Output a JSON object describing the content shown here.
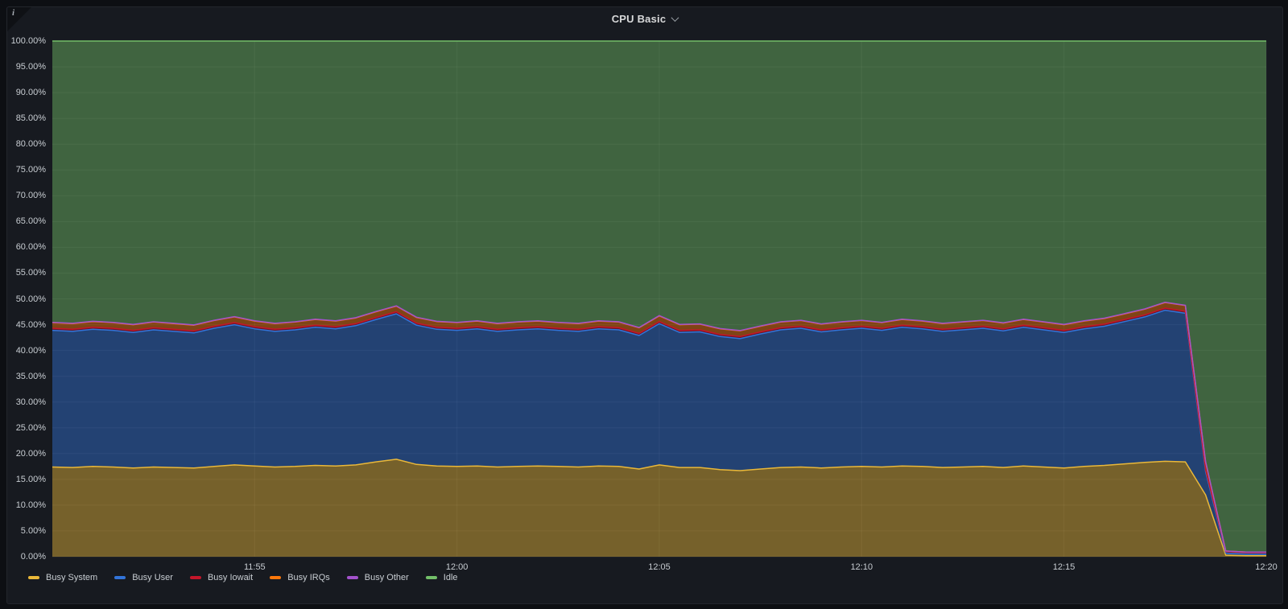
{
  "panel": {
    "title": "CPU Basic",
    "info_icon": "i",
    "chevron_icon": "chevron-down"
  },
  "colors": {
    "page_bg": "#0d0f13",
    "panel_bg": "#171a20",
    "grid": "rgba(255,255,255,0.07)",
    "axis_text": "#c8cdd2",
    "title_text": "#d8d9da"
  },
  "chart_data": {
    "type": "area",
    "stacked": true,
    "unit": "percent",
    "title": "CPU Basic",
    "grid": true,
    "legend_position": "bottom-left",
    "ylim": [
      0,
      100
    ],
    "x_start_label": "11:50",
    "x_minutes_span": 30,
    "x_step_minutes": 0.5,
    "fill_opacity": 0.45,
    "x_ticks": [
      {
        "t": 5,
        "label": "11:55"
      },
      {
        "t": 10,
        "label": "12:00"
      },
      {
        "t": 15,
        "label": "12:05"
      },
      {
        "t": 20,
        "label": "12:10"
      },
      {
        "t": 25,
        "label": "12:15"
      },
      {
        "t": 30,
        "label": "12:20"
      }
    ],
    "y_ticks": [
      {
        "value": 100,
        "label": "100.00%"
      },
      {
        "value": 95,
        "label": "95.00%"
      },
      {
        "value": 90,
        "label": "90.00%"
      },
      {
        "value": 85,
        "label": "85.00%"
      },
      {
        "value": 80,
        "label": "80.00%"
      },
      {
        "value": 75,
        "label": "75.00%"
      },
      {
        "value": 70,
        "label": "70.00%"
      },
      {
        "value": 65,
        "label": "65.00%"
      },
      {
        "value": 60,
        "label": "60.00%"
      },
      {
        "value": 55,
        "label": "55.00%"
      },
      {
        "value": 50,
        "label": "50.00%"
      },
      {
        "value": 45,
        "label": "45.00%"
      },
      {
        "value": 40,
        "label": "40.00%"
      },
      {
        "value": 35,
        "label": "35.00%"
      },
      {
        "value": 30,
        "label": "30.00%"
      },
      {
        "value": 25,
        "label": "25.00%"
      },
      {
        "value": 20,
        "label": "20.00%"
      },
      {
        "value": 15,
        "label": "15.00%"
      },
      {
        "value": 10,
        "label": "10.00%"
      },
      {
        "value": 5,
        "label": "5.00%"
      },
      {
        "value": 0,
        "label": "0.00%"
      }
    ],
    "series": [
      {
        "name": "Busy System",
        "color": "#EAB839",
        "values": [
          17.4,
          17.3,
          17.5,
          17.4,
          17.2,
          17.4,
          17.3,
          17.2,
          17.5,
          17.8,
          17.6,
          17.4,
          17.5,
          17.7,
          17.6,
          17.8,
          18.4,
          18.9,
          17.9,
          17.6,
          17.5,
          17.6,
          17.4,
          17.5,
          17.6,
          17.5,
          17.4,
          17.6,
          17.5,
          17.0,
          17.8,
          17.3,
          17.3,
          16.9,
          16.7,
          17.0,
          17.3,
          17.4,
          17.2,
          17.4,
          17.5,
          17.4,
          17.6,
          17.5,
          17.3,
          17.4,
          17.5,
          17.3,
          17.6,
          17.4,
          17.2,
          17.5,
          17.7,
          18.0,
          18.3,
          18.5,
          18.4,
          12.0,
          0.3,
          0.2,
          0.2
        ]
      },
      {
        "name": "Busy User",
        "color": "#3274D9",
        "values": [
          26.5,
          26.4,
          26.6,
          26.5,
          26.3,
          26.6,
          26.4,
          26.2,
          26.8,
          27.2,
          26.6,
          26.3,
          26.5,
          26.8,
          26.6,
          27.0,
          27.6,
          28.2,
          27.0,
          26.5,
          26.4,
          26.6,
          26.3,
          26.5,
          26.6,
          26.4,
          26.3,
          26.6,
          26.5,
          25.9,
          27.4,
          26.2,
          26.3,
          25.8,
          25.6,
          26.2,
          26.7,
          26.9,
          26.4,
          26.6,
          26.8,
          26.5,
          26.9,
          26.7,
          26.4,
          26.6,
          26.8,
          26.5,
          26.9,
          26.6,
          26.3,
          26.7,
          27.0,
          27.6,
          28.2,
          29.3,
          28.8,
          4.5,
          0.4,
          0.3,
          0.3
        ]
      },
      {
        "name": "Busy Iowait",
        "color": "#C4162A",
        "values": [
          0.4,
          0.4,
          0.4,
          0.4,
          0.4,
          0.4,
          0.4,
          0.4,
          0.4,
          0.4,
          0.4,
          0.4,
          0.4,
          0.4,
          0.4,
          0.4,
          0.4,
          0.4,
          0.4,
          0.4,
          0.4,
          0.4,
          0.4,
          0.4,
          0.4,
          0.4,
          0.4,
          0.4,
          0.4,
          0.4,
          0.4,
          0.4,
          0.4,
          0.4,
          0.4,
          0.4,
          0.4,
          0.4,
          0.4,
          0.4,
          0.4,
          0.4,
          0.4,
          0.4,
          0.4,
          0.4,
          0.4,
          0.4,
          0.4,
          0.4,
          0.4,
          0.4,
          0.4,
          0.4,
          0.4,
          0.4,
          0.4,
          0.4,
          0.3,
          0.3,
          0.3
        ]
      },
      {
        "name": "Busy IRQs",
        "color": "#FF780A",
        "values": [
          1.1,
          1.1,
          1.1,
          1.1,
          1.1,
          1.1,
          1.1,
          1.1,
          1.1,
          1.1,
          1.1,
          1.1,
          1.1,
          1.1,
          1.1,
          1.1,
          1.1,
          1.1,
          1.1,
          1.1,
          1.1,
          1.1,
          1.1,
          1.1,
          1.1,
          1.1,
          1.1,
          1.1,
          1.1,
          1.1,
          1.1,
          1.1,
          1.1,
          1.1,
          1.1,
          1.1,
          1.1,
          1.1,
          1.1,
          1.1,
          1.1,
          1.1,
          1.1,
          1.1,
          1.1,
          1.1,
          1.1,
          1.1,
          1.1,
          1.1,
          1.1,
          1.1,
          1.1,
          1.1,
          1.1,
          1.1,
          1.1,
          1.5,
          0.1,
          0.1,
          0.1
        ]
      },
      {
        "name": "Busy Other",
        "color": "#A352CC",
        "values": [
          0.05,
          0.05,
          0.05,
          0.05,
          0.05,
          0.05,
          0.05,
          0.05,
          0.05,
          0.05,
          0.05,
          0.05,
          0.05,
          0.05,
          0.05,
          0.05,
          0.05,
          0.05,
          0.05,
          0.05,
          0.05,
          0.05,
          0.05,
          0.05,
          0.05,
          0.05,
          0.05,
          0.05,
          0.05,
          0.05,
          0.05,
          0.05,
          0.05,
          0.05,
          0.05,
          0.05,
          0.05,
          0.05,
          0.05,
          0.05,
          0.05,
          0.05,
          0.05,
          0.05,
          0.05,
          0.05,
          0.05,
          0.05,
          0.05,
          0.05,
          0.05,
          0.05,
          0.05,
          0.05,
          0.05,
          0.05,
          0.05,
          0.05,
          0.0,
          0.0,
          0.0
        ]
      },
      {
        "name": "Idle",
        "color": "#73BF69",
        "values": [
          54.55,
          54.75,
          54.35,
          54.55,
          54.95,
          54.45,
          54.75,
          55.05,
          54.15,
          53.45,
          54.25,
          54.75,
          54.45,
          53.95,
          54.25,
          53.65,
          52.45,
          51.35,
          53.55,
          54.35,
          54.55,
          54.25,
          54.75,
          54.45,
          54.25,
          54.55,
          54.75,
          54.25,
          54.45,
          55.55,
          53.25,
          54.95,
          54.85,
          55.75,
          56.15,
          55.25,
          54.45,
          54.15,
          54.85,
          54.45,
          54.15,
          54.55,
          53.95,
          54.25,
          54.75,
          54.45,
          54.15,
          54.65,
          53.95,
          54.45,
          54.95,
          54.25,
          53.75,
          52.85,
          51.95,
          50.65,
          51.25,
          81.55,
          98.9,
          99.1,
          99.1
        ]
      }
    ]
  }
}
